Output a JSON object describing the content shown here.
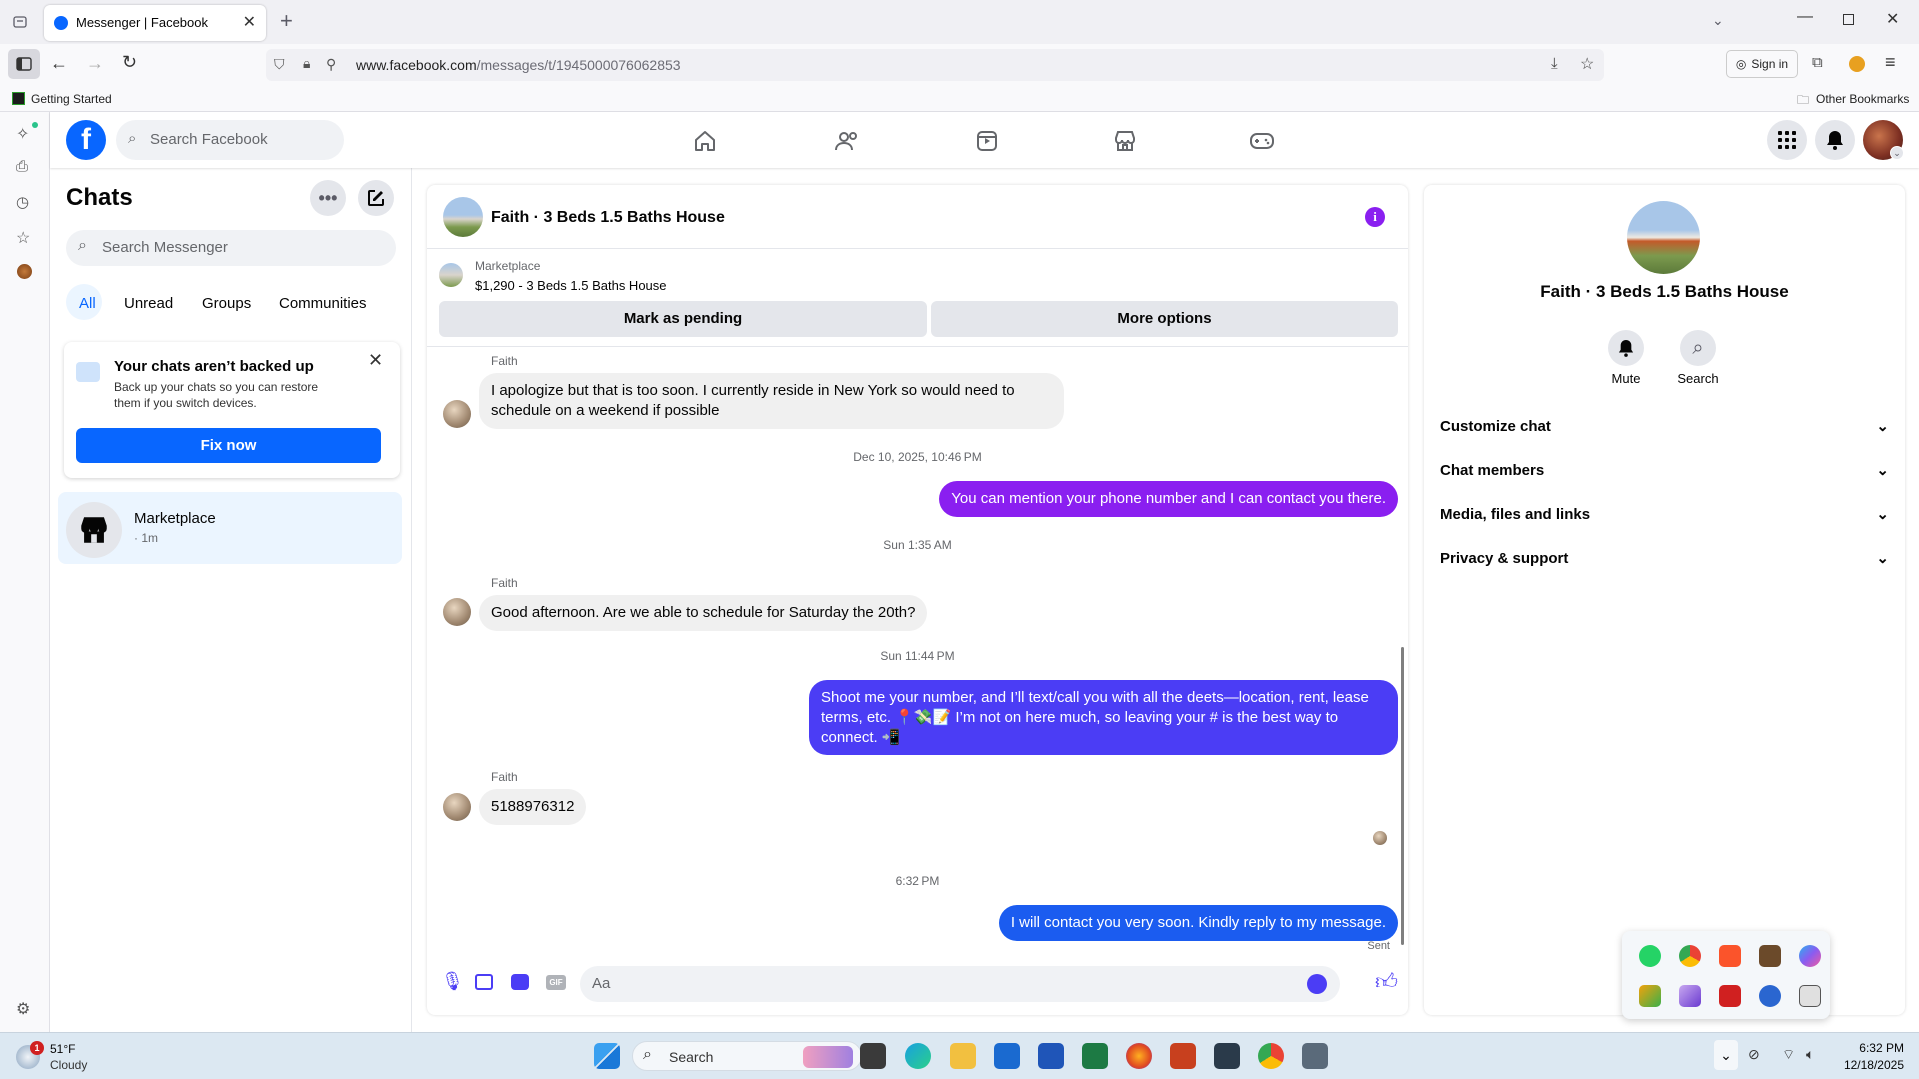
{
  "browser": {
    "tab_title": "Messenger | Facebook",
    "url_domain": "www.facebook.com",
    "url_path": "/messages/t/1945000076062853",
    "sign_in": "Sign in",
    "bookmark_left": "Getting Started",
    "bookmark_right": "Other Bookmarks"
  },
  "header": {
    "search_placeholder": "Search Facebook"
  },
  "chats": {
    "title": "Chats",
    "search_placeholder": "Search Messenger",
    "filters": [
      "All",
      "Unread",
      "Groups",
      "Communities"
    ],
    "backup": {
      "title": "Your chats aren’t backed up",
      "body": "Back up your chats so you can restore them if you switch devices.",
      "button": "Fix now"
    },
    "items": [
      {
        "name": "Marketplace",
        "meta": "· 1m"
      }
    ]
  },
  "conversation": {
    "title": "Faith · 3 Beds 1.5 Baths House",
    "listing_source": "Marketplace",
    "listing_title": "$1,290 - 3 Beds 1.5 Baths House",
    "btn_pending": "Mark as pending",
    "btn_more": "More options",
    "messages": [
      {
        "sender": "Faith",
        "text": "I apologize but that is too soon. I currently reside in New York so would need to schedule on a weekend if possible"
      },
      {
        "timestamp": "Dec 10, 2025, 10:46 PM"
      },
      {
        "text": "You can mention your phone number and I can contact you there."
      },
      {
        "timestamp": "Sun 1:35 AM"
      },
      {
        "sender": "Faith",
        "text": "Good afternoon. Are we able to schedule for Saturday the 20th?"
      },
      {
        "timestamp": "Sun 11:44 PM"
      },
      {
        "text": "Shoot me your number, and I’ll text/call you with all the deets—location, rent, lease terms, etc. 📍💸📝 I’m not on here much, so leaving your # is the best way to connect. 📲"
      },
      {
        "sender": "Faith",
        "text": "5188976312"
      },
      {
        "timestamp": "6:32 PM"
      },
      {
        "text": "I will contact you very soon. Kindly reply to my message.",
        "status": "Sent"
      }
    ],
    "composer_placeholder": "Aa"
  },
  "info": {
    "title": "Faith · 3 Beds 1.5 Baths House",
    "actions": [
      "Mute",
      "Search"
    ],
    "sections": [
      "Customize chat",
      "Chat members",
      "Media, files and links",
      "Privacy & support"
    ]
  },
  "taskbar": {
    "weather_temp": "51°F",
    "weather_desc": "Cloudy",
    "weather_badge": "1",
    "search_label": "Search",
    "time": "6:32 PM",
    "date": "12/18/2025"
  },
  "colors": {
    "fb_blue": "#0866ff",
    "purple_bubble": "#8a1ff0",
    "blue_purple_bubble": "#4b3df5",
    "blue_bubble": "#1b5cf0"
  }
}
